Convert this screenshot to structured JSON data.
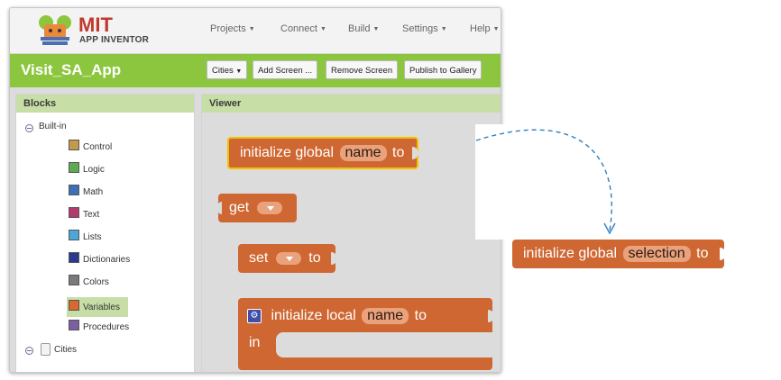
{
  "header": {
    "logo_title": "MIT",
    "logo_subtitle": "APP INVENTOR",
    "menu": [
      "Projects",
      "Connect",
      "Build",
      "Settings",
      "Help"
    ]
  },
  "project_bar": {
    "title": "Visit_SA_App",
    "screen_select": "Cities",
    "buttons": [
      "Add Screen ...",
      "Remove Screen",
      "Publish to Gallery"
    ]
  },
  "blocks_panel": {
    "title": "Blocks",
    "builtin_label": "Built-in",
    "categories": [
      {
        "label": "Control",
        "color": "#c49a4a"
      },
      {
        "label": "Logic",
        "color": "#5dab4f"
      },
      {
        "label": "Math",
        "color": "#3d6fb6"
      },
      {
        "label": "Text",
        "color": "#b33a6d"
      },
      {
        "label": "Lists",
        "color": "#4aa8d8"
      },
      {
        "label": "Dictionaries",
        "color": "#2a3a8f"
      },
      {
        "label": "Colors",
        "color": "#7a7a7a"
      },
      {
        "label": "Variables",
        "color": "#d9692f"
      },
      {
        "label": "Procedures",
        "color": "#7b5ea3"
      }
    ],
    "screen_label": "Cities"
  },
  "viewer": {
    "title": "Viewer",
    "init_global": {
      "prefix": "initialize global",
      "name": "name",
      "suffix": "to"
    },
    "get_label": "get",
    "set": {
      "prefix": "set",
      "suffix": "to"
    },
    "init_local": {
      "prefix": "initialize local",
      "name": "name",
      "suffix": "to",
      "in_label": "in"
    }
  },
  "result_block": {
    "prefix": "initialize global",
    "name": "selection",
    "suffix": "to"
  },
  "colors": {
    "block": "#cf6732",
    "accent_green": "#8cc63f",
    "panel_head": "#c7dfa6"
  }
}
